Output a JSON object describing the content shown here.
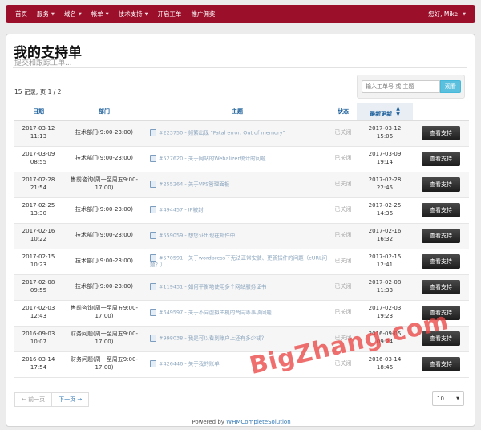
{
  "nav": {
    "items": [
      {
        "label": "首页",
        "caret": false
      },
      {
        "label": "服务",
        "caret": true
      },
      {
        "label": "域名",
        "caret": true
      },
      {
        "label": "帐单",
        "caret": true
      },
      {
        "label": "技术支持",
        "caret": true
      },
      {
        "label": "开启工单",
        "caret": false
      },
      {
        "label": "推广佣奖",
        "caret": false
      }
    ],
    "user_greeting": "您好, Mike!",
    "accent_color": "#9b0f2b"
  },
  "page": {
    "title": "我的支持单",
    "subtitle": "提交和跟踪工单..."
  },
  "records_info": "15 记录, 页 1 / 2",
  "search": {
    "placeholder": "输入工单号 或 主题",
    "button_label": "观看"
  },
  "table": {
    "headers": {
      "date": "日期",
      "department": "部门",
      "subject": "主题",
      "status": "状态",
      "last_updated": "最新更新"
    },
    "view_label": "查看支持",
    "rows": [
      {
        "date": "2017-03-12",
        "time": "11:13",
        "department": "技术部门(9:00-23:00)",
        "subject": "#223750 - 频繁出现 \"Fatal error: Out of memory\"",
        "status": "已关闭",
        "updated_date": "2017-03-12",
        "updated_time": "15:06"
      },
      {
        "date": "2017-03-09",
        "time": "08:55",
        "department": "技术部门(9:00-23:00)",
        "subject": "#527620 - 关于网站的Webalizer统计的问题",
        "status": "已关闭",
        "updated_date": "2017-03-09",
        "updated_time": "19:14"
      },
      {
        "date": "2017-02-28",
        "time": "21:54",
        "department": "售前咨询(周一至周五9:00-17:00)",
        "subject": "#255264 - 关于VPS管理面板",
        "status": "已关闭",
        "updated_date": "2017-02-28",
        "updated_time": "22:45"
      },
      {
        "date": "2017-02-25",
        "time": "13:30",
        "department": "技术部门(9:00-23:00)",
        "subject": "#494457 - IP被封",
        "status": "已关闭",
        "updated_date": "2017-02-25",
        "updated_time": "14:36"
      },
      {
        "date": "2017-02-16",
        "time": "10:22",
        "department": "技术部门(9:00-23:00)",
        "subject": "#559059 - 想您证出现在邮件中",
        "status": "已关闭",
        "updated_date": "2017-02-16",
        "updated_time": "16:32"
      },
      {
        "date": "2017-02-15",
        "time": "10:23",
        "department": "技术部门(9:00-23:00)",
        "subject": "#570591 - 关于wordpress下无法正常安装、更新插件的问题（cURL问题？）",
        "status": "已关闭",
        "updated_date": "2017-02-15",
        "updated_time": "12:41"
      },
      {
        "date": "2017-02-08",
        "time": "09:55",
        "department": "技术部门(9:00-23:00)",
        "subject": "#119431 - 如何平衡地使用多个网站服务证书",
        "status": "已关闭",
        "updated_date": "2017-02-08",
        "updated_time": "11:33"
      },
      {
        "date": "2017-02-03",
        "time": "12:43",
        "department": "售前咨询(周一至周五9:00-17:00)",
        "subject": "#649597 - 关于不同虚拟主机的合同等事项问题",
        "status": "已关闭",
        "updated_date": "2017-02-03",
        "updated_time": "19:23"
      },
      {
        "date": "2016-09-03",
        "time": "10:07",
        "department": "财务问题(周一至周五9:00-17:00)",
        "subject": "#998038 - 我是可以看到账户上还有多少钱？",
        "status": "已关闭",
        "updated_date": "2016-09-05",
        "updated_time": "09:24"
      },
      {
        "date": "2016-03-14",
        "time": "17:54",
        "department": "财务问题(周一至周五9:00-17:00)",
        "subject": "#426446 - 关于我的账单",
        "status": "已关闭",
        "updated_date": "2016-03-14",
        "updated_time": "18:46"
      }
    ]
  },
  "pagination": {
    "prev_label": "← 前一页",
    "next_label": "下一页 →",
    "per_page": "10"
  },
  "footer": {
    "prefix": "Powered by ",
    "link_text": "WHMCompleteSolution"
  },
  "watermark": "BigZhang.com"
}
